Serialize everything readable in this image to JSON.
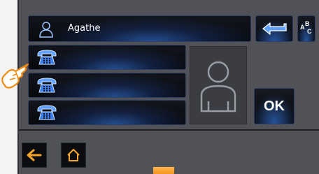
{
  "contact": {
    "name": "Agathe"
  },
  "phone_entries": [
    {
      "icon": "phone-icon",
      "value": ""
    },
    {
      "icon": "phone-icon",
      "value": ""
    },
    {
      "icon": "phone-icon",
      "value": ""
    }
  ],
  "buttons": {
    "ok_label": "OK",
    "abc_letters": [
      "A",
      "B",
      "C"
    ]
  },
  "icons": [
    "person-icon",
    "phone-icon",
    "back-arrow-icon",
    "abc-keyboard-icon",
    "avatar-placeholder-icon",
    "home-icon",
    "pointing-hand-icon"
  ],
  "colors": {
    "accent_blue": "#3c87ff",
    "nav_orange": "#f7a52a",
    "panel_bg": "#505257",
    "ok_text": "#ffffff"
  }
}
